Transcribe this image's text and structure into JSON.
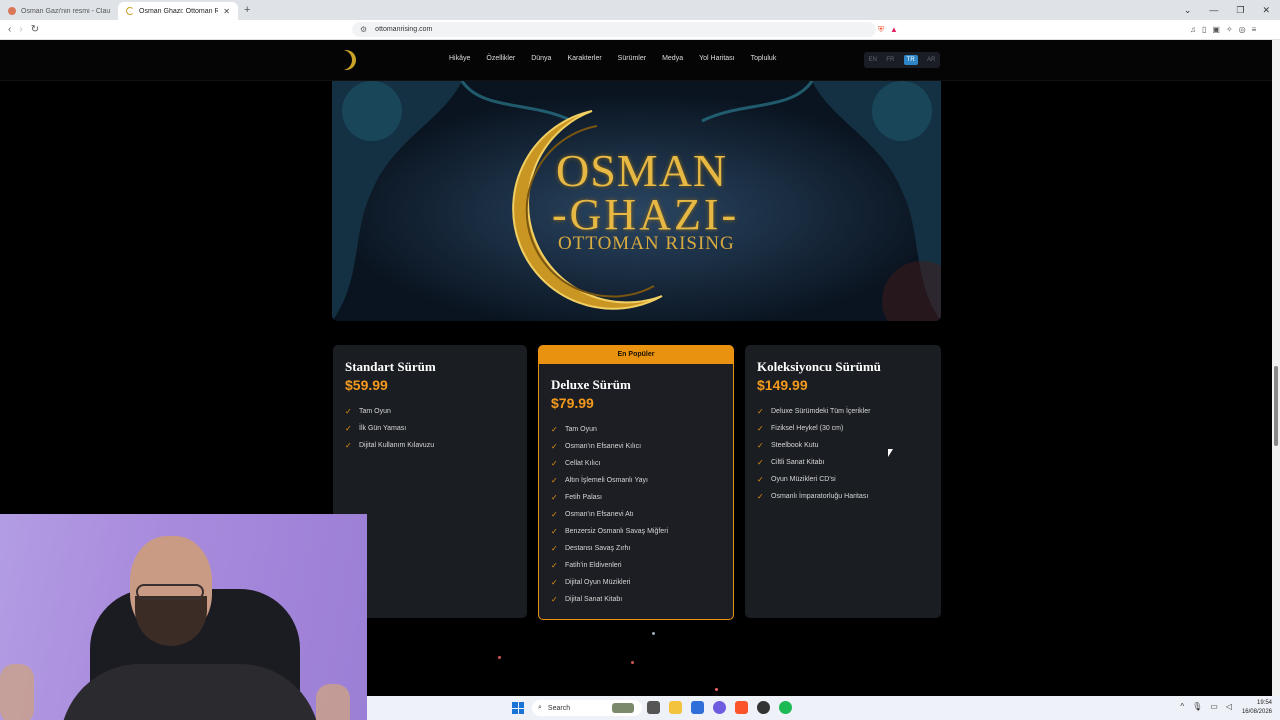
{
  "browser": {
    "tabs": [
      {
        "label": "Osman Gazi'nin resmi - Claude",
        "active": false
      },
      {
        "label": "Osman Ghazi: Ottoman Rising -",
        "active": true
      }
    ],
    "url": "ottomanrising.com"
  },
  "site": {
    "nav": [
      "Hikâye",
      "Özellikler",
      "Dünya",
      "Karakterler",
      "Sürümler",
      "Medya",
      "Yol Haritası",
      "Topluluk"
    ],
    "languages": [
      "EN",
      "FR",
      "TR",
      "AR"
    ],
    "active_language": "TR",
    "hero": {
      "line1": "OSMAN",
      "line2": "-GHAZI-",
      "line3": "OTTOMAN RISING"
    },
    "editions": [
      {
        "name": "Standart Sürüm",
        "price": "$59.99",
        "badge": "",
        "features": [
          "Tam Oyun",
          "İlk Gün Yaması",
          "Dijital Kullanım Kılavuzu"
        ]
      },
      {
        "name": "Deluxe Sürüm",
        "price": "$79.99",
        "badge": "En Popüler",
        "features": [
          "Tam Oyun",
          "Osman'ın Efsanevi Kılıcı",
          "Cellat Kılıcı",
          "Altın İşlemeli Osmanlı Yayı",
          "Fetih Palası",
          "Osman'ın Efsanevi Atı",
          "Benzersiz Osmanlı Savaş Miğferi",
          "Destansı Savaş Zırhı",
          "Fatih'in Eldivenleri",
          "Dijital Oyun Müzikleri",
          "Dijital Sanat Kitabı"
        ]
      },
      {
        "name": "Koleksiyoncu Sürümü",
        "price": "$149.99",
        "badge": "",
        "features": [
          "Deluxe Sürümdeki Tüm İçerikler",
          "Fiziksel Heykel (30 cm)",
          "Steelbook Kutu",
          "Ciltli Sanat Kitabı",
          "Oyun Müzikleri CD'si",
          "Osmanlı İmparatorluğu Haritası"
        ]
      }
    ]
  },
  "taskbar": {
    "search_placeholder": "Search",
    "time": "19:54",
    "date": "16/08/2026"
  },
  "colors": {
    "accent": "#e8920f",
    "price": "#f39a1d",
    "gold": "#e7b944",
    "lang_active": "#2f86c6"
  }
}
